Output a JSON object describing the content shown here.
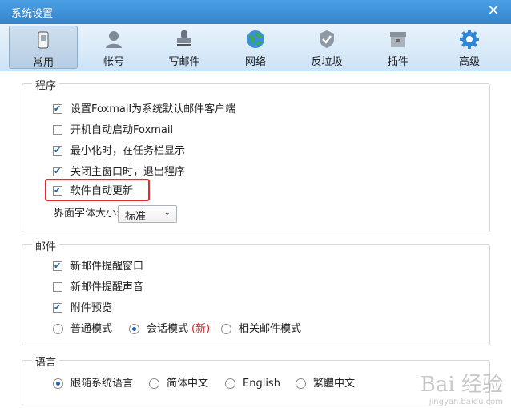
{
  "window": {
    "title": "系统设置"
  },
  "toolbar": {
    "tabs": [
      {
        "label": "常用",
        "icon": "phone-icon",
        "active": true
      },
      {
        "label": "帐号",
        "icon": "user-icon",
        "active": false
      },
      {
        "label": "写邮件",
        "icon": "stamp-icon",
        "active": false
      },
      {
        "label": "网络",
        "icon": "globe-icon",
        "active": false
      },
      {
        "label": "反垃圾",
        "icon": "shield-icon",
        "active": false
      },
      {
        "label": "插件",
        "icon": "box-icon",
        "active": false
      },
      {
        "label": "高级",
        "icon": "gear-icon",
        "active": false
      }
    ]
  },
  "program": {
    "title": "程序",
    "options": [
      {
        "label": "设置Foxmail为系统默认邮件客户端",
        "checked": true
      },
      {
        "label": "开机自动启动Foxmail",
        "checked": false
      },
      {
        "label": "最小化时，在任务栏显示",
        "checked": true
      },
      {
        "label": "关闭主窗口时，退出程序",
        "checked": true
      },
      {
        "label": "软件自动更新",
        "checked": true
      }
    ],
    "font_size_label": "界面字体大小:",
    "font_size_value": "标准"
  },
  "mail": {
    "title": "邮件",
    "options": [
      {
        "label": "新邮件提醒窗口",
        "checked": true
      },
      {
        "label": "新邮件提醒声音",
        "checked": false
      },
      {
        "label": "附件预览",
        "checked": true
      }
    ],
    "modes": [
      {
        "label": "普通模式",
        "checked": false
      },
      {
        "label": "会话模式",
        "tag": "(新)",
        "checked": true
      },
      {
        "label": "相关邮件模式",
        "checked": false
      }
    ]
  },
  "language": {
    "title": "语言",
    "options": [
      {
        "label": "跟随系统语言",
        "checked": true
      },
      {
        "label": "简体中文",
        "checked": false
      },
      {
        "label": "English",
        "checked": false
      },
      {
        "label": "繁體中文",
        "checked": false
      }
    ]
  },
  "watermark": {
    "main": "Bai 经验",
    "sub": "jingyan.baidu.com"
  }
}
